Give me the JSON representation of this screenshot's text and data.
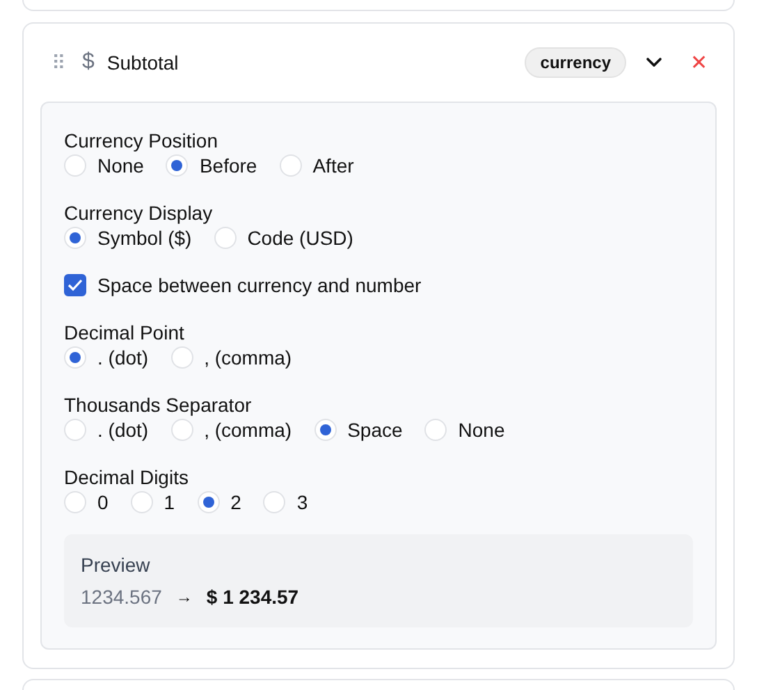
{
  "field": {
    "title": "Subtotal",
    "type_badge": "currency",
    "drag_handle": "⠿",
    "currency_symbol": "$",
    "close": "✕"
  },
  "settings": [
    {
      "kind": "radio",
      "label": "Currency Position",
      "options": [
        {
          "label": "None",
          "selected": false
        },
        {
          "label": "Before",
          "selected": true
        },
        {
          "label": "After",
          "selected": false
        }
      ]
    },
    {
      "kind": "radio",
      "label": "Currency Display",
      "options": [
        {
          "label": "Symbol ($)",
          "selected": true
        },
        {
          "label": "Code (USD)",
          "selected": false
        }
      ]
    },
    {
      "kind": "checkbox",
      "label": "Space between currency and number",
      "checked": true
    },
    {
      "kind": "radio",
      "label": "Decimal Point",
      "options": [
        {
          "label": ". (dot)",
          "selected": true
        },
        {
          "label": ", (comma)",
          "selected": false
        }
      ]
    },
    {
      "kind": "radio",
      "label": "Thousands Separator",
      "options": [
        {
          "label": ". (dot)",
          "selected": false
        },
        {
          "label": ", (comma)",
          "selected": false
        },
        {
          "label": "Space",
          "selected": true
        },
        {
          "label": "None",
          "selected": false
        }
      ]
    },
    {
      "kind": "radio",
      "label": "Decimal Digits",
      "options": [
        {
          "label": "0",
          "selected": false
        },
        {
          "label": "1",
          "selected": false
        },
        {
          "label": "2",
          "selected": true
        },
        {
          "label": "3",
          "selected": false
        }
      ]
    }
  ],
  "preview": {
    "label": "Preview",
    "input": "1234.567",
    "arrow": "→",
    "output": "$ 1 234.57"
  }
}
